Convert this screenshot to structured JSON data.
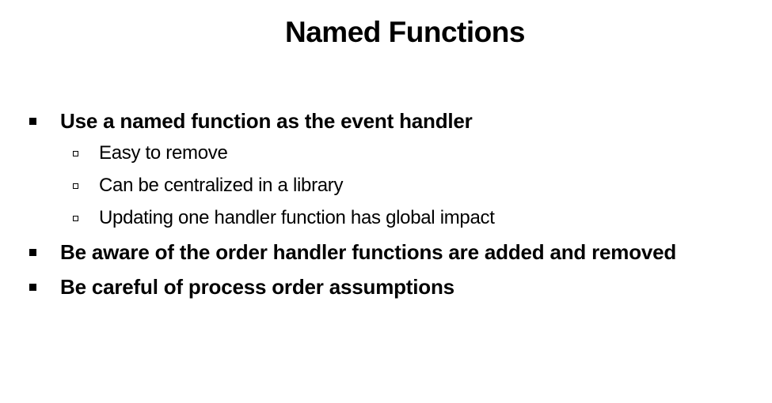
{
  "slide": {
    "title": "Named Functions",
    "bullets": [
      {
        "text": "Use a named function as the event handler",
        "sub": [
          "Easy to remove",
          "Can be centralized in a library",
          "Updating one handler function has global impact"
        ]
      },
      {
        "text": "Be aware of the order handler functions are added and removed",
        "sub": []
      },
      {
        "text": "Be careful of process order assumptions",
        "sub": []
      }
    ]
  }
}
